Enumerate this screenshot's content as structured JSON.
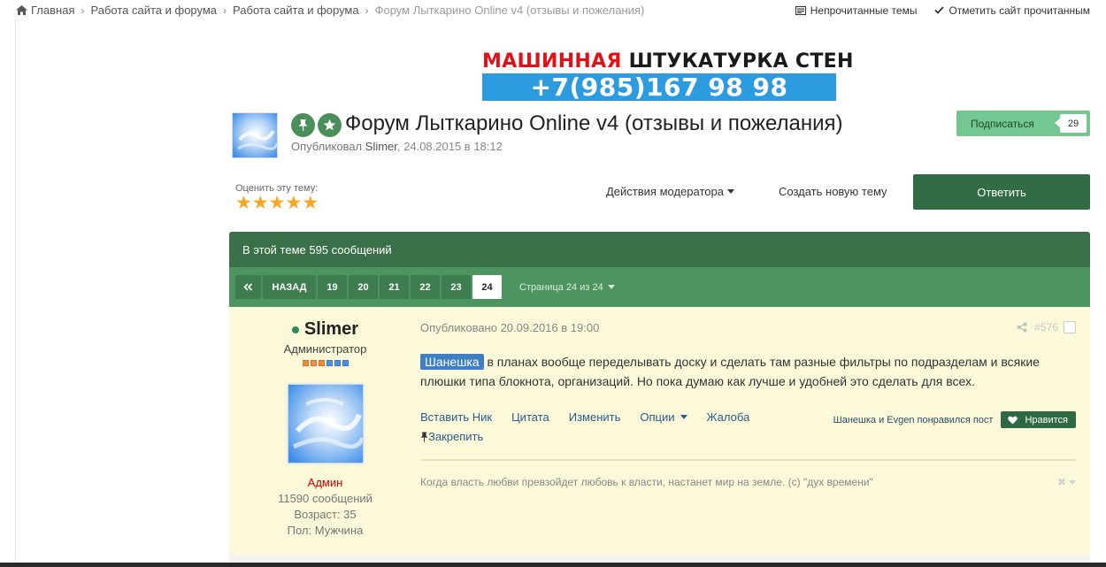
{
  "breadcrumb": {
    "items": [
      "Главная",
      "Работа сайта и форума",
      "Работа сайта и форума",
      "Форум Лыткарино Online v4 (отзывы и пожелания)"
    ]
  },
  "top_links": {
    "unread": "Непрочитанные темы",
    "mark_read": "Отметить сайт прочитанным"
  },
  "banner": {
    "part1": "МАШИННАЯ",
    "part2": "ШТУКАТУРКА СТЕН",
    "phone": "+7(985)167 98 98"
  },
  "topic": {
    "title": "Форум Лыткарино Online v4 (отзывы и пожелания)",
    "meta_prefix": "Опубликовал",
    "author": "Slimer",
    "date": ", 24.08.2015 в 18:12",
    "follow_label": "Подписаться",
    "follow_count": "29",
    "rate_label": "Оценить эту тему:",
    "rating_stars": 5,
    "mod_actions": "Действия модератора",
    "new_topic": "Создать новую тему",
    "reply": "Ответить"
  },
  "thread": {
    "count_text": "В этой теме 595 сообщений"
  },
  "pagination": {
    "prev": "НАЗАД",
    "pages": [
      "19",
      "20",
      "21",
      "22",
      "23",
      "24"
    ],
    "active": "24",
    "info": "Страница 24 из 24"
  },
  "post": {
    "author": {
      "name": "Slimer",
      "title": "Администратор",
      "group": "Админ",
      "posts": "11590 сообщений",
      "age": "Возраст: 35",
      "gender": "Пол: Мужчина",
      "pip_colors": [
        "#f08a3c",
        "#f08a3c",
        "#f08a3c",
        "#4a8fe0",
        "#4a8fe0",
        "#4a8fe0"
      ]
    },
    "date": "Опубликовано 20.09.2016 в 19:00",
    "number": "#576",
    "mention": "Шанешка",
    "text_line1": " в планах вообще переделывать доску и сделать там разные фильтры по подразделам и всякие",
    "text_line2": "плюшки типа блокнота, организаций. Но пока думаю как лучше и удобней это сделать для всех.",
    "actions": [
      "Вставить Ник",
      "Цитата",
      "Изменить",
      "Опции",
      "Жалоба"
    ],
    "pin": "Закрепить",
    "reaction_text": "Шанешка и Evgen понравился пост",
    "like_label": "Нравится",
    "signature": "Когда власть любви превзойдет любовь к власти, настанет мир на земле. (с) \"дух времени\""
  },
  "colors": {
    "accent_green": "#3a7048",
    "pager_green": "#4e9460",
    "post_bg": "#fbf9d9",
    "mention_blue": "#3d7fc7",
    "group_red": "#cc0000"
  }
}
